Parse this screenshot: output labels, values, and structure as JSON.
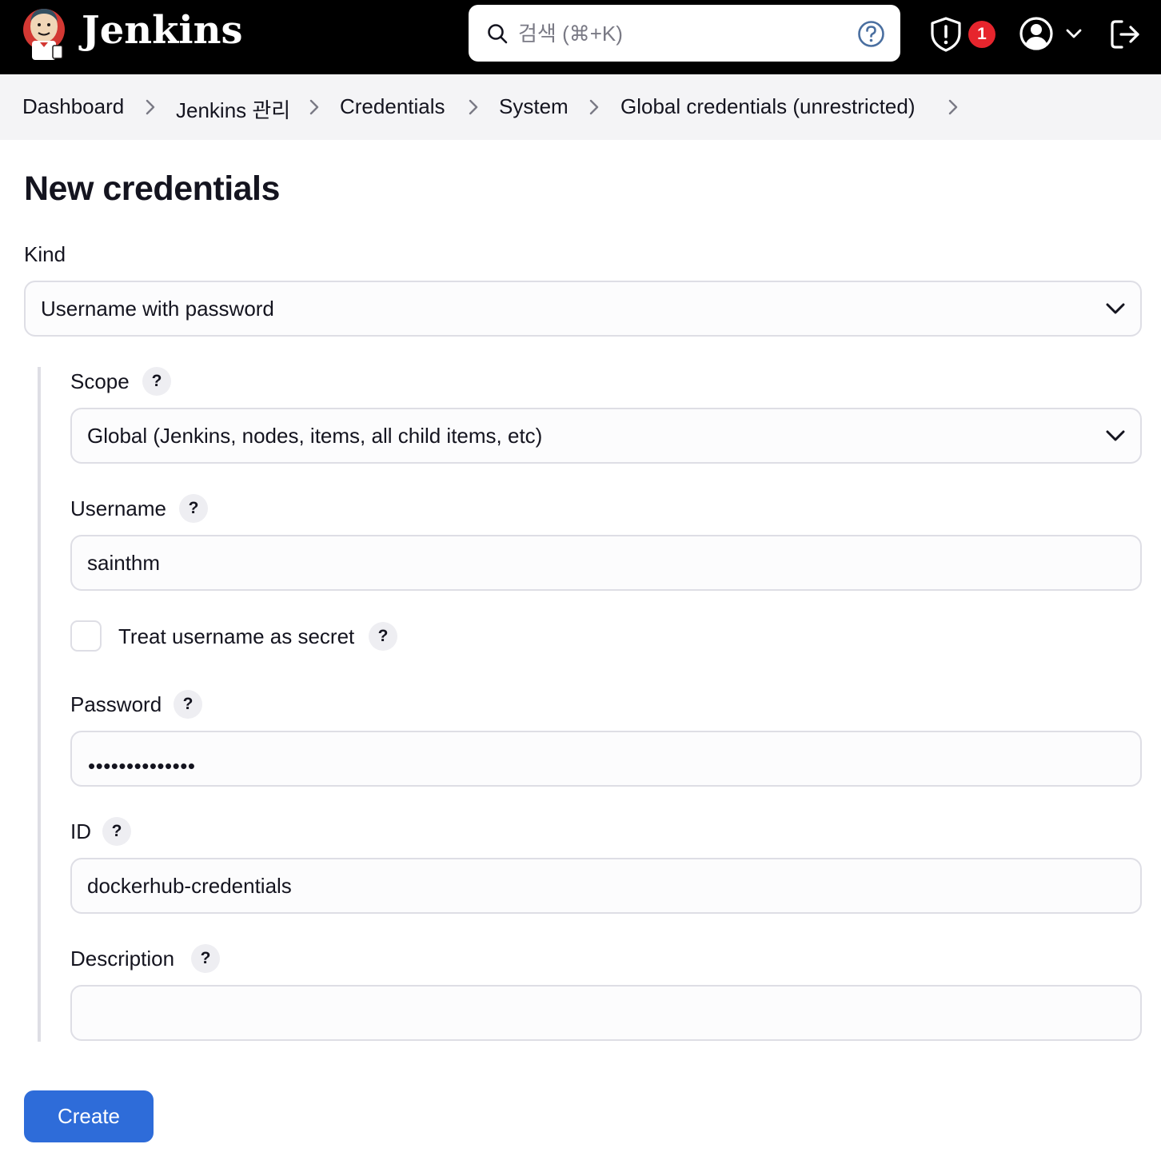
{
  "header": {
    "brand": "Jenkins",
    "search_placeholder": "검색 (⌘+K)",
    "security_badge_count": "1"
  },
  "breadcrumb": [
    {
      "label": "Dashboard"
    },
    {
      "label": "Jenkins 관리"
    },
    {
      "label": "Credentials"
    },
    {
      "label": "System"
    },
    {
      "label": "Global credentials (unrestricted)"
    }
  ],
  "page": {
    "title": "New credentials"
  },
  "form": {
    "kind": {
      "label": "Kind",
      "value": "Username with password"
    },
    "scope": {
      "label": "Scope",
      "value": "Global (Jenkins, nodes, items, all child items, etc)"
    },
    "username": {
      "label": "Username",
      "value": "sainthm"
    },
    "treat_secret": {
      "label": "Treat username as secret",
      "checked": false
    },
    "password": {
      "label": "Password",
      "masked_value": "••••••••••••••"
    },
    "id": {
      "label": "ID",
      "value": "dockerhub-credentials"
    },
    "description": {
      "label": "Description",
      "value": ""
    },
    "help_glyph": "?",
    "create_label": "Create"
  },
  "colors": {
    "header_bg": "#000000",
    "breadcrumb_bg": "#f4f4f6",
    "badge": "#e6252d",
    "primary_button": "#2e6cd9",
    "field_border": "#dedee5"
  }
}
